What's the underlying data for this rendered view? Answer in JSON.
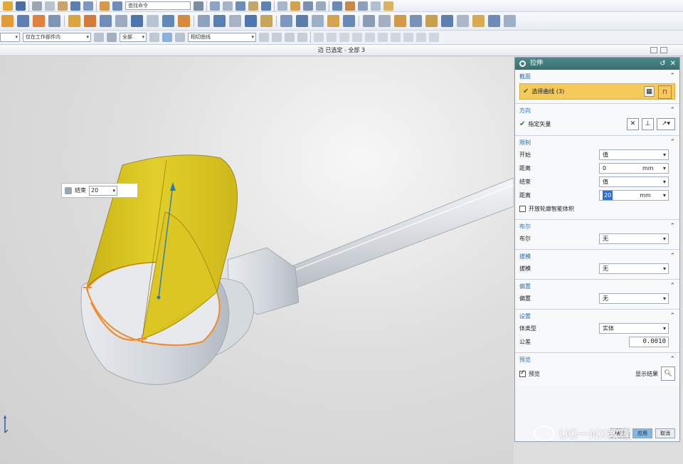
{
  "toolbar": {
    "command_search": "查找命令",
    "filter_combo": "仅在工作部件内",
    "scope_combo": "全部",
    "curve_rule_combo": "相切曲线"
  },
  "status_bar": {
    "text": "边 已选定 - 全部 3"
  },
  "viewport": {
    "floating_label": "结束",
    "floating_value": "20"
  },
  "dialog": {
    "title": "拉伸",
    "section": {
      "header": "截面",
      "select_curve": "选择曲线 (3)"
    },
    "direction": {
      "header": "方向",
      "specify_vector": "指定矢量"
    },
    "limits": {
      "header": "限制",
      "start_label": "开始",
      "start_value": "值",
      "distance1_label": "距离",
      "distance1_value": "0",
      "distance1_unit": "mm",
      "end_label": "结束",
      "end_value": "值",
      "distance2_label": "距离",
      "distance2_value": "20",
      "distance2_unit": "mm",
      "open_profile": "开放轮廓智能体积"
    },
    "boolean": {
      "header": "布尔",
      "label": "布尔",
      "value": "无"
    },
    "draft": {
      "header": "拔模",
      "label": "拔模",
      "value": "无"
    },
    "offset": {
      "header": "偏置",
      "label": "偏置",
      "value": "无"
    },
    "settings": {
      "header": "设置",
      "body_type_label": "体类型",
      "body_type_value": "实体",
      "tolerance_label": "公差",
      "tolerance_value": "0.0010"
    },
    "preview": {
      "header": "预览",
      "checkbox_label": "预览",
      "show_result": "显示结果"
    },
    "footer": {
      "ok": "确定",
      "apply": "应用",
      "cancel": "取消"
    }
  },
  "watermark": "UG一NX教程",
  "colors": {
    "sheet_yellow": "#d8c21c",
    "highlight_orange": "#f5c95a",
    "title_teal": "#3f7c7d",
    "edge_orange": "#f08a2a"
  }
}
